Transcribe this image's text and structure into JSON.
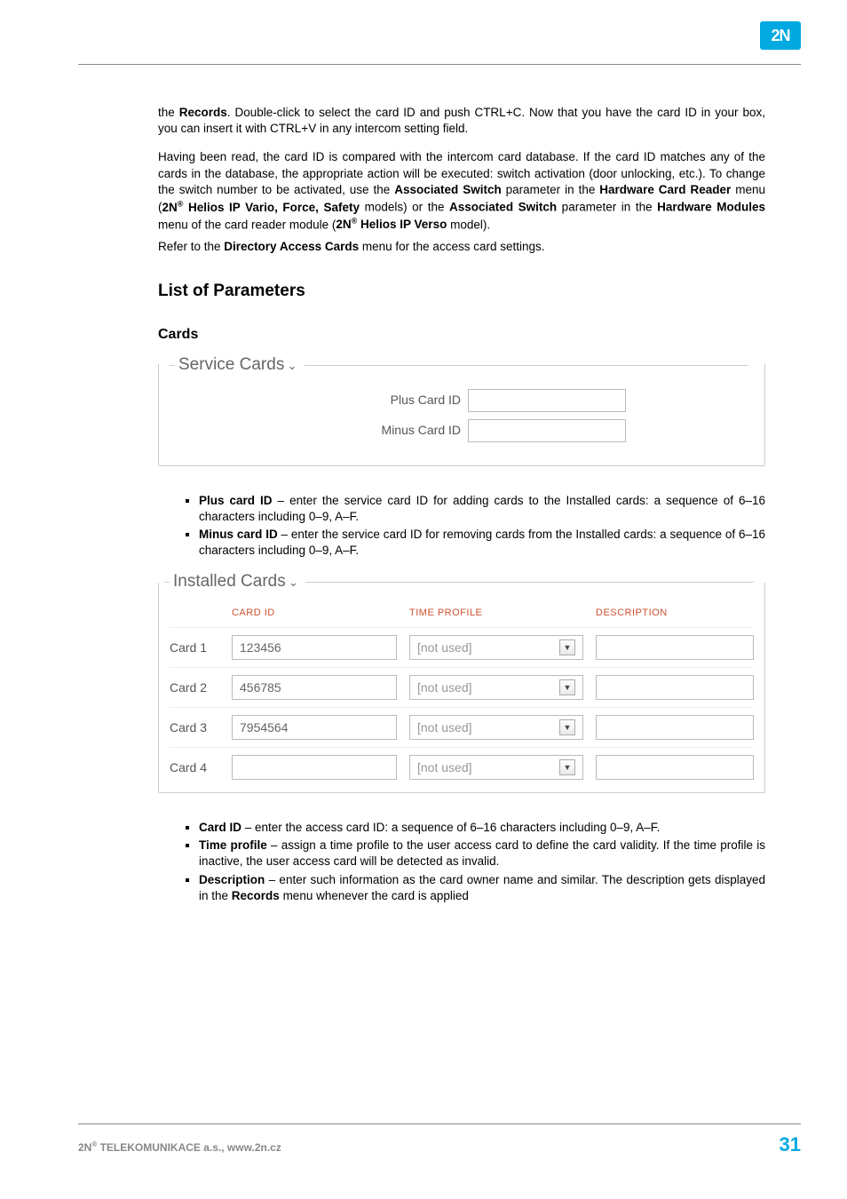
{
  "logo": "2N",
  "para1": {
    "t1": "the ",
    "b1": "Records",
    "t2": ". Double-click to select the card ID and push CTRL+C. Now that you have the card ID in your box, you can insert it with CTRL+V in any intercom setting field."
  },
  "para2": {
    "t1": "Having been read, the card ID is compared with the intercom card database. If the card ID matches any of the cards in the database, the appropriate action will be executed: switch activation (door unlocking, etc.). To change the switch number to be activated, use the ",
    "b1": "Associated Switch",
    "t2": " parameter in the ",
    "b2": "Hardware  Card Reader",
    "t3": " menu (",
    "b3a": "2N",
    "b3b": " Helios IP Vario, Force, Safety",
    "t4": " models) or the ",
    "b4": "Associated Switch",
    "t5": " parameter in the ",
    "b5": "Hardware   Modules",
    "t6": " menu of the card reader module (",
    "b6a": "2N",
    "b6b": " Helios IP Verso",
    "t7": " model)."
  },
  "para3": {
    "t1": "Refer to the ",
    "b1": "Directory  Access Cards",
    "t2": " menu for the access card settings."
  },
  "h2": "List of Parameters",
  "h3": "Cards",
  "serviceCards": {
    "legend": "Service Cards",
    "plusLabel": "Plus Card ID",
    "minusLabel": "Minus Card ID",
    "plusValue": "",
    "minusValue": ""
  },
  "bullets1": [
    {
      "b": "Plus card ID",
      "t": " – enter the service card ID for adding cards to the Installed cards: a sequence of 6–16 characters including 0–9, A–F."
    },
    {
      "b": "Minus card ID",
      "t": " –  enter the service card ID for removing cards from the Installed cards: a sequence of 6–16 characters including 0–9, A–F."
    }
  ],
  "installed": {
    "legend": "Installed Cards",
    "headers": {
      "id": "CARD ID",
      "profile": "TIME PROFILE",
      "desc": "DESCRIPTION"
    },
    "rows": [
      {
        "label": "Card 1",
        "id": "123456",
        "profile": "[not used]",
        "desc": ""
      },
      {
        "label": "Card 2",
        "id": "456785",
        "profile": "[not used]",
        "desc": ""
      },
      {
        "label": "Card 3",
        "id": "7954564",
        "profile": "[not used]",
        "desc": ""
      },
      {
        "label": "Card 4",
        "id": "",
        "profile": "[not used]",
        "desc": ""
      }
    ]
  },
  "bullets2": [
    {
      "b": "Card ID",
      "t": " – enter the access card ID: a sequence of 6–16 characters including 0–9, A–F."
    },
    {
      "b": "Time profile",
      "t": " – assign a time profile to the user access card to define the card validity. If the time profile is inactive, the user access card will be detected as invalid."
    },
    {
      "b": "Description",
      "t1": " – enter such information as the card owner name and similar. The description gets displayed in the ",
      "b2": "Records",
      "t2": " menu whenever the card is applied"
    }
  ],
  "footer": {
    "left1": "2N",
    "left2": " TELEKOMUNIKACE a.s., www.2n.cz",
    "page": "31",
    "reg": "®"
  }
}
